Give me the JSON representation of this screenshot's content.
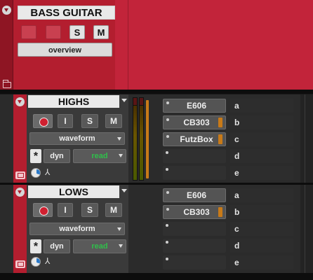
{
  "folder_track": {
    "name": "BASS GUITAR",
    "solo_label": "S",
    "mute_label": "M",
    "view_button": "overview"
  },
  "tracks": [
    {
      "name": "HIGHS",
      "input_label": "I",
      "solo_label": "S",
      "mute_label": "M",
      "view": "waveform",
      "automation_type": "dyn",
      "automation_mode": "read",
      "inserts": [
        "E606",
        "CB303",
        "FutzBox",
        "",
        ""
      ],
      "sends": [
        "a",
        "b",
        "c",
        "d",
        "e"
      ]
    },
    {
      "name": "LOWS",
      "input_label": "I",
      "solo_label": "S",
      "mute_label": "M",
      "view": "waveform",
      "automation_type": "dyn",
      "automation_mode": "read",
      "inserts": [
        "E606",
        "CB303",
        "",
        "",
        ""
      ],
      "sends": [
        "a",
        "b",
        "c",
        "d",
        "e"
      ]
    }
  ],
  "icons": {
    "expand": "chevron-down-icon",
    "folder": "folder-icon",
    "record": "record-arm-icon",
    "asterisk": "asterisk-icon",
    "playlist": "playlist-icon",
    "pan": "pan-dial-icon",
    "voice": "voice-icon"
  },
  "colors": {
    "folder_red": "#b31e2f",
    "read_green": "#2fbf4a",
    "meter_orange": "#c87a18"
  }
}
